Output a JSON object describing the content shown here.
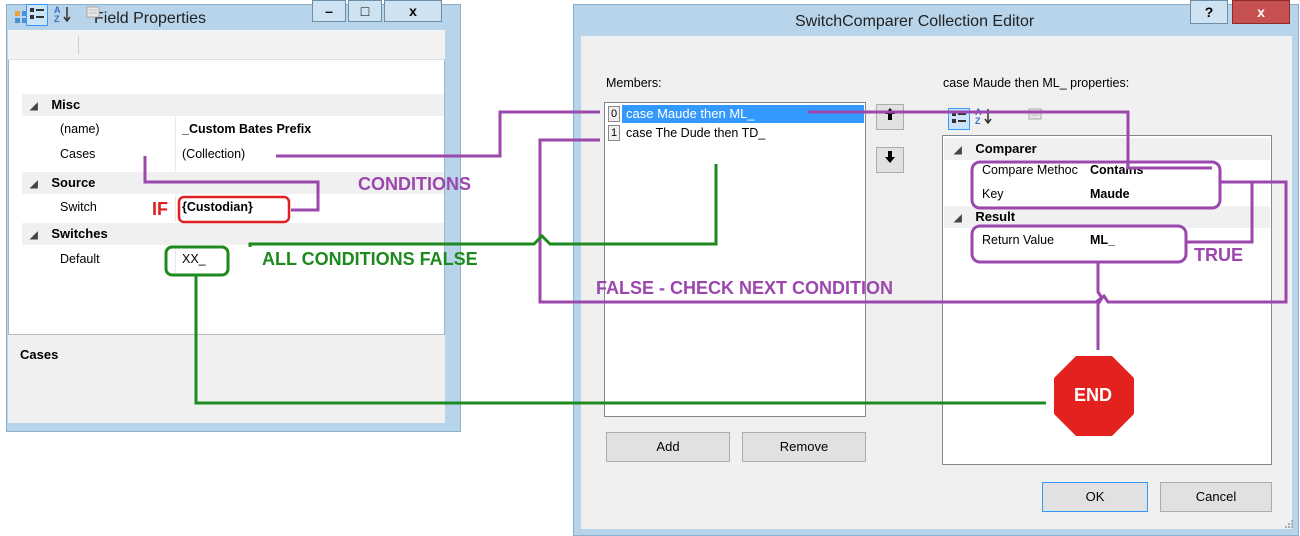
{
  "colors": {
    "purple": "#9b47ad",
    "green": "#1e8a1e",
    "red": "#e02020",
    "end_octagon": "#e3211e",
    "selection": "#3399ff"
  },
  "field_properties": {
    "title": "Field Properties",
    "app_icon": "window-app-icon",
    "window_buttons": {
      "minimize": "–",
      "maximize": "□",
      "close": "x"
    },
    "toolbar_icons": [
      "categorized-icon",
      "alphabetical-icon",
      "property-pages-icon"
    ],
    "categories": [
      {
        "name": "Misc",
        "rows": [
          {
            "name": "(name)",
            "value": "_Custom Bates Prefix"
          },
          {
            "name": "Cases",
            "value": "(Collection)"
          }
        ]
      },
      {
        "name": "Source",
        "rows": [
          {
            "name": "Switch",
            "value": "{Custodian}"
          }
        ]
      },
      {
        "name": "Switches",
        "rows": [
          {
            "name": "Default",
            "value": "XX_"
          }
        ]
      }
    ],
    "description_title": "Cases"
  },
  "collection_editor": {
    "title": "SwitchComparer Collection Editor",
    "help": "?",
    "close": "x",
    "members_label": "Members:",
    "members": [
      {
        "index": "0",
        "text": "case Maude then ML_"
      },
      {
        "index": "1",
        "text": "case The Dude then TD_"
      }
    ],
    "properties_label": "case Maude then ML_ properties:",
    "up_arrow": "🠉",
    "down_arrow": "🠋",
    "prop_categories": [
      {
        "name": "Comparer",
        "rows": [
          {
            "name": "Compare Methoc",
            "value": "Contains"
          },
          {
            "name": "Key",
            "value": "Maude"
          }
        ]
      },
      {
        "name": "Result",
        "rows": [
          {
            "name": "Return Value",
            "value": "ML_"
          }
        ]
      }
    ],
    "add_label": "Add",
    "remove_label": "Remove",
    "ok_label": "OK",
    "cancel_label": "Cancel"
  },
  "annotations": {
    "conditions": "CONDITIONS",
    "if": "IF",
    "all_false": "ALL CONDITIONS FALSE",
    "false_next": "FALSE - CHECK NEXT CONDITION",
    "true": "TRUE",
    "end": "END"
  }
}
